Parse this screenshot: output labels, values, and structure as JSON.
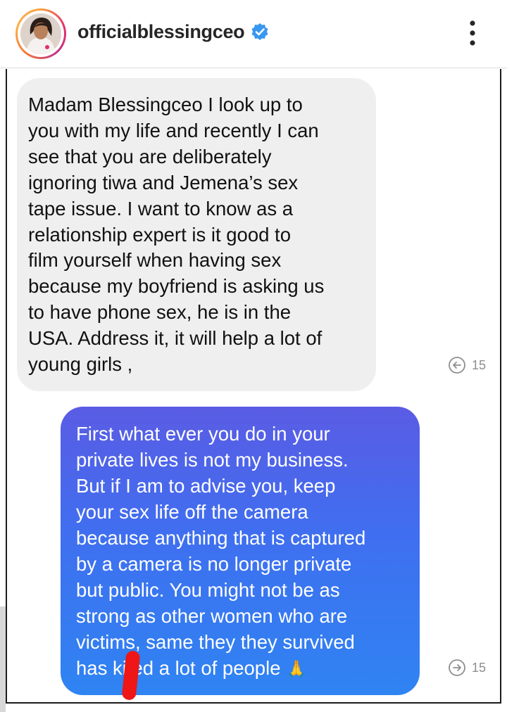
{
  "header": {
    "username": "officialblessingceo",
    "verified_icon": "verified-badge-icon",
    "more_icon": "more-vertical-icon"
  },
  "messages": [
    {
      "direction": "incoming",
      "text": "Madam Blessingceo I look up to you with my life and recently I can see that you are deliberately ignoring tiwa and Jemena’s sex tape issue. I want to know as a relationship expert is it good to film yourself when having sex because my boyfriend is asking us to have phone sex, he is in the USA. Address it, it will help a lot of young girls ,",
      "lines": [
        "Madam Blessingceo I look up to",
        "you with my life and recently I can",
        "see that you are deliberately",
        "ignoring tiwa and Jemena’s sex",
        "tape issue. I want to know as a",
        "relationship expert is it good to",
        "film yourself when having sex",
        "because my boyfriend is asking us",
        "to have phone sex, he is in the",
        "USA. Address it, it will help a lot of",
        "young girls ,"
      ],
      "meta_icon": "arrow-left-circle-icon",
      "meta_count": "15"
    },
    {
      "direction": "outgoing",
      "text": "First what ever you do in your private lives is not my business. But if I am to advise you, keep your sex life off the camera because anything that is captured by a camera is no longer private but public. You might not be as strong as other women who are victims, same they they survived has ki ed a lot of people 🙏",
      "lines": [
        "First what ever you do in your",
        "private lives is not my business.",
        "But if I am to advise you, keep",
        "your sex life off the camera",
        "because anything that is captured",
        "by a camera is no longer private",
        "but public. You might not be as",
        "strong as other women who are",
        "victims, same they they survived",
        "has ki ed a lot of people"
      ],
      "emoji": "🙏",
      "meta_icon": "arrow-right-circle-icon",
      "meta_count": "15"
    }
  ],
  "colors": {
    "incoming_bubble": "#efefef",
    "outgoing_gradient_top": "#5a5ce4",
    "outgoing_gradient_bottom": "#2f84f2",
    "verified": "#3897f0",
    "annotation_mark": "#ee1616"
  }
}
